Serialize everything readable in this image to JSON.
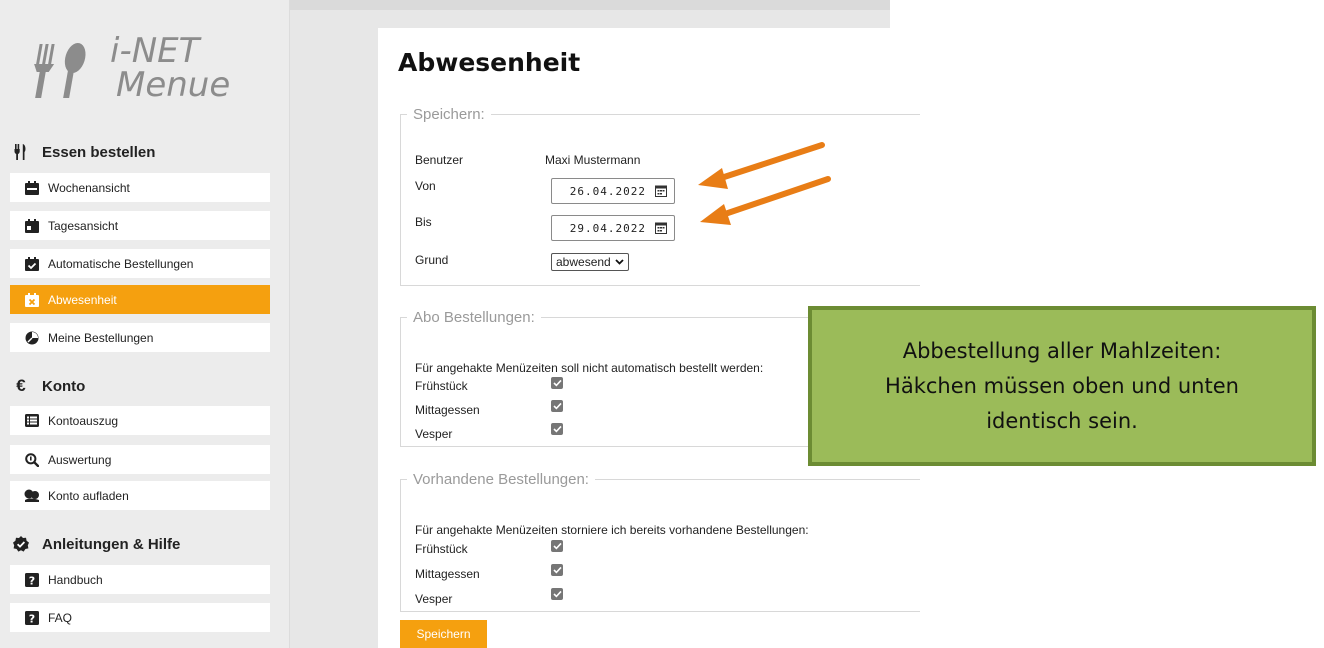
{
  "logo": {
    "line1": "i-NET",
    "line2": "Menue"
  },
  "sidebar": {
    "sections": [
      {
        "title": "Essen bestellen",
        "icon": "fork-knife-icon"
      },
      {
        "title": "Konto",
        "icon": "euro-icon"
      },
      {
        "title": "Anleitungen & Hilfe",
        "icon": "badge-check-icon"
      }
    ],
    "items": [
      {
        "label": "Wochenansicht",
        "icon": "calendar-week-icon"
      },
      {
        "label": "Tagesansicht",
        "icon": "calendar-day-icon"
      },
      {
        "label": "Automatische Bestellungen",
        "icon": "calendar-check-icon"
      },
      {
        "label": "Abwesenheit",
        "icon": "calendar-x-icon",
        "active": true
      },
      {
        "label": "Meine Bestellungen",
        "icon": "pie-chart-icon"
      },
      {
        "label": "Kontoauszug",
        "icon": "list-icon"
      },
      {
        "label": "Auswertung",
        "icon": "magnifier-icon"
      },
      {
        "label": "Konto aufladen",
        "icon": "hand-coin-icon"
      },
      {
        "label": "Handbuch",
        "icon": "question-square-icon"
      },
      {
        "label": "FAQ",
        "icon": "question-square-icon"
      }
    ]
  },
  "main": {
    "title": "Abwesenheit",
    "save_section": {
      "legend": "Speichern:",
      "user_label": "Benutzer",
      "user_value": "Maxi Mustermann",
      "from_label": "Von",
      "from_value": "26.04.2022",
      "to_label": "Bis",
      "to_value": "29.04.2022",
      "reason_label": "Grund",
      "reason_value": "abwesend"
    },
    "abo_section": {
      "legend": "Abo Bestellungen:",
      "description": "Für angehakte Menüzeiten soll nicht automatisch bestellt werden:",
      "meals": [
        {
          "label": "Frühstück",
          "checked": true
        },
        {
          "label": "Mittagessen",
          "checked": true
        },
        {
          "label": "Vesper",
          "checked": true
        }
      ]
    },
    "existing_section": {
      "legend": "Vorhandene Bestellungen:",
      "description": "Für angehakte Menüzeiten storniere ich bereits vorhandene Bestellungen:",
      "meals": [
        {
          "label": "Frühstück",
          "checked": true
        },
        {
          "label": "Mittagessen",
          "checked": true
        },
        {
          "label": "Vesper",
          "checked": true
        }
      ]
    },
    "save_button": "Speichern"
  },
  "callout": {
    "lines": [
      "Abbestellung aller Mahlzeiten:",
      "Häkchen müssen oben und unten",
      "identisch sein."
    ]
  },
  "colors": {
    "accent": "#f5a00f",
    "callout_bg": "#9bbb59",
    "callout_border": "#6c8c33",
    "arrow": "#e87d16",
    "sidebar_bg": "#ececec"
  }
}
